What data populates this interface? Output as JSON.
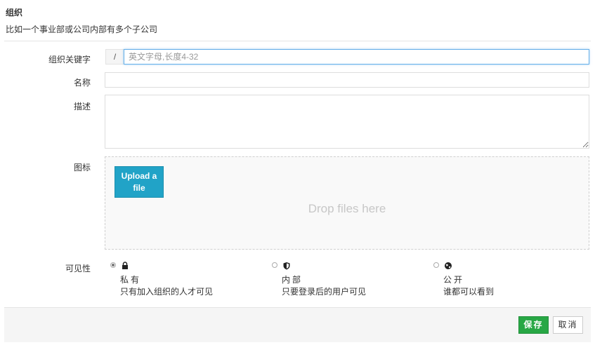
{
  "header": {
    "title": "组织",
    "subtitle": "比如一个事业部或公司内部有多个子公司"
  },
  "form": {
    "key_label": "组织关键字",
    "key_prefix": "/",
    "key_placeholder": "英文字母,长度4-32",
    "key_value": "",
    "name_label": "名称",
    "name_value": "",
    "desc_label": "描述",
    "desc_value": "",
    "icon_label": "图标",
    "upload_label": "Upload a file",
    "drop_text": "Drop files here",
    "visibility_label": "可见性",
    "visibility_options": [
      {
        "name": "私有",
        "desc": "只有加入组织的人才可见",
        "icon": "lock-icon",
        "checked": true
      },
      {
        "name": "内部",
        "desc": "只要登录后的用户可见",
        "icon": "shield-icon",
        "checked": false
      },
      {
        "name": "公开",
        "desc": "谁都可以看到",
        "icon": "globe-icon",
        "checked": false
      }
    ]
  },
  "footer": {
    "save_label": "保存",
    "cancel_label": "取消"
  },
  "colors": {
    "save": "#28a745",
    "upload": "#21a3c7",
    "focus": "#66afe9"
  }
}
